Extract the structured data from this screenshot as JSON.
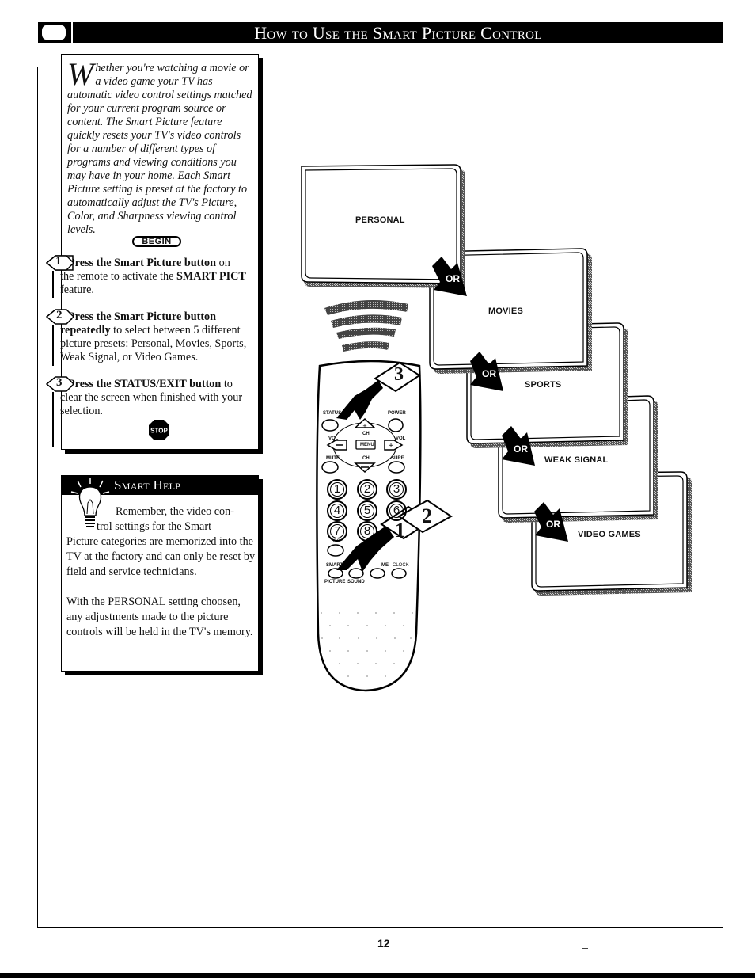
{
  "header": {
    "title": "How to Use the Smart Picture Control",
    "icon": "tv-icon"
  },
  "intro": {
    "dropcap": "W",
    "text": "hether you're watching a movie or a video game your TV has automatic video control settings matched for your current program source or content. The Smart Picture feature quickly resets your TV's video controls for a number of different types of programs and viewing conditions you may have in your home.  Each Smart Picture setting is preset at the factory to automatically adjust the TV's Picture, Color, and Sharpness viewing control levels.",
    "begin_label": "BEGIN"
  },
  "steps": [
    {
      "number": "1",
      "bold": "Press the Smart Picture button",
      "rest_a": " on",
      "rest_b": "the remote to activate the ",
      "bold2": "SMART PICT",
      "rest_c": " feature."
    },
    {
      "number": "2",
      "bold": "Press the Smart Picture button",
      "bold2": "repeatedly",
      "rest_c": " to select between 5 different picture presets: Personal, Movies, Sports, Weak Signal, or Video Games."
    },
    {
      "number": "3",
      "bold": "Press the STATUS/EXIT button",
      "rest_a": " to",
      "rest_c": "clear the screen when finished with your selection."
    }
  ],
  "stop_label": "STOP",
  "smart_help": {
    "title": "Smart Help",
    "para1_line1": "Remember,  the video con-",
    "para1_line2": "trol settings for the Smart",
    "para1_rest": "Picture categories are memorized into the TV at the factory and can only be reset by field and service technicians.",
    "para2": "With the PERSONAL setting choosen, any adjustments made to the picture controls will be held in the TV's memory."
  },
  "tv_screens": [
    {
      "label": "PERSONAL"
    },
    {
      "label": "MOVIES"
    },
    {
      "label": "SPORTS"
    },
    {
      "label": "WEAK SIGNAL"
    },
    {
      "label": "VIDEO GAMES"
    }
  ],
  "or_label": "OR",
  "remote": {
    "labels": {
      "status": "STATUS",
      "power": "POWER",
      "vol": "VOL",
      "ch": "CH",
      "menu": "MENU",
      "mute": "MUTE",
      "surf": "SURF",
      "cc": "CC",
      "smart": "SMART",
      "me": "ME",
      "clock": "CLOCK",
      "picture": "PICTURE",
      "sound": "SOUND"
    },
    "digits": [
      "1",
      "2",
      "3",
      "4",
      "5",
      "6",
      "7",
      "8"
    ],
    "callouts": [
      "3",
      "1",
      "2"
    ]
  },
  "footer": {
    "page_number": "12"
  }
}
